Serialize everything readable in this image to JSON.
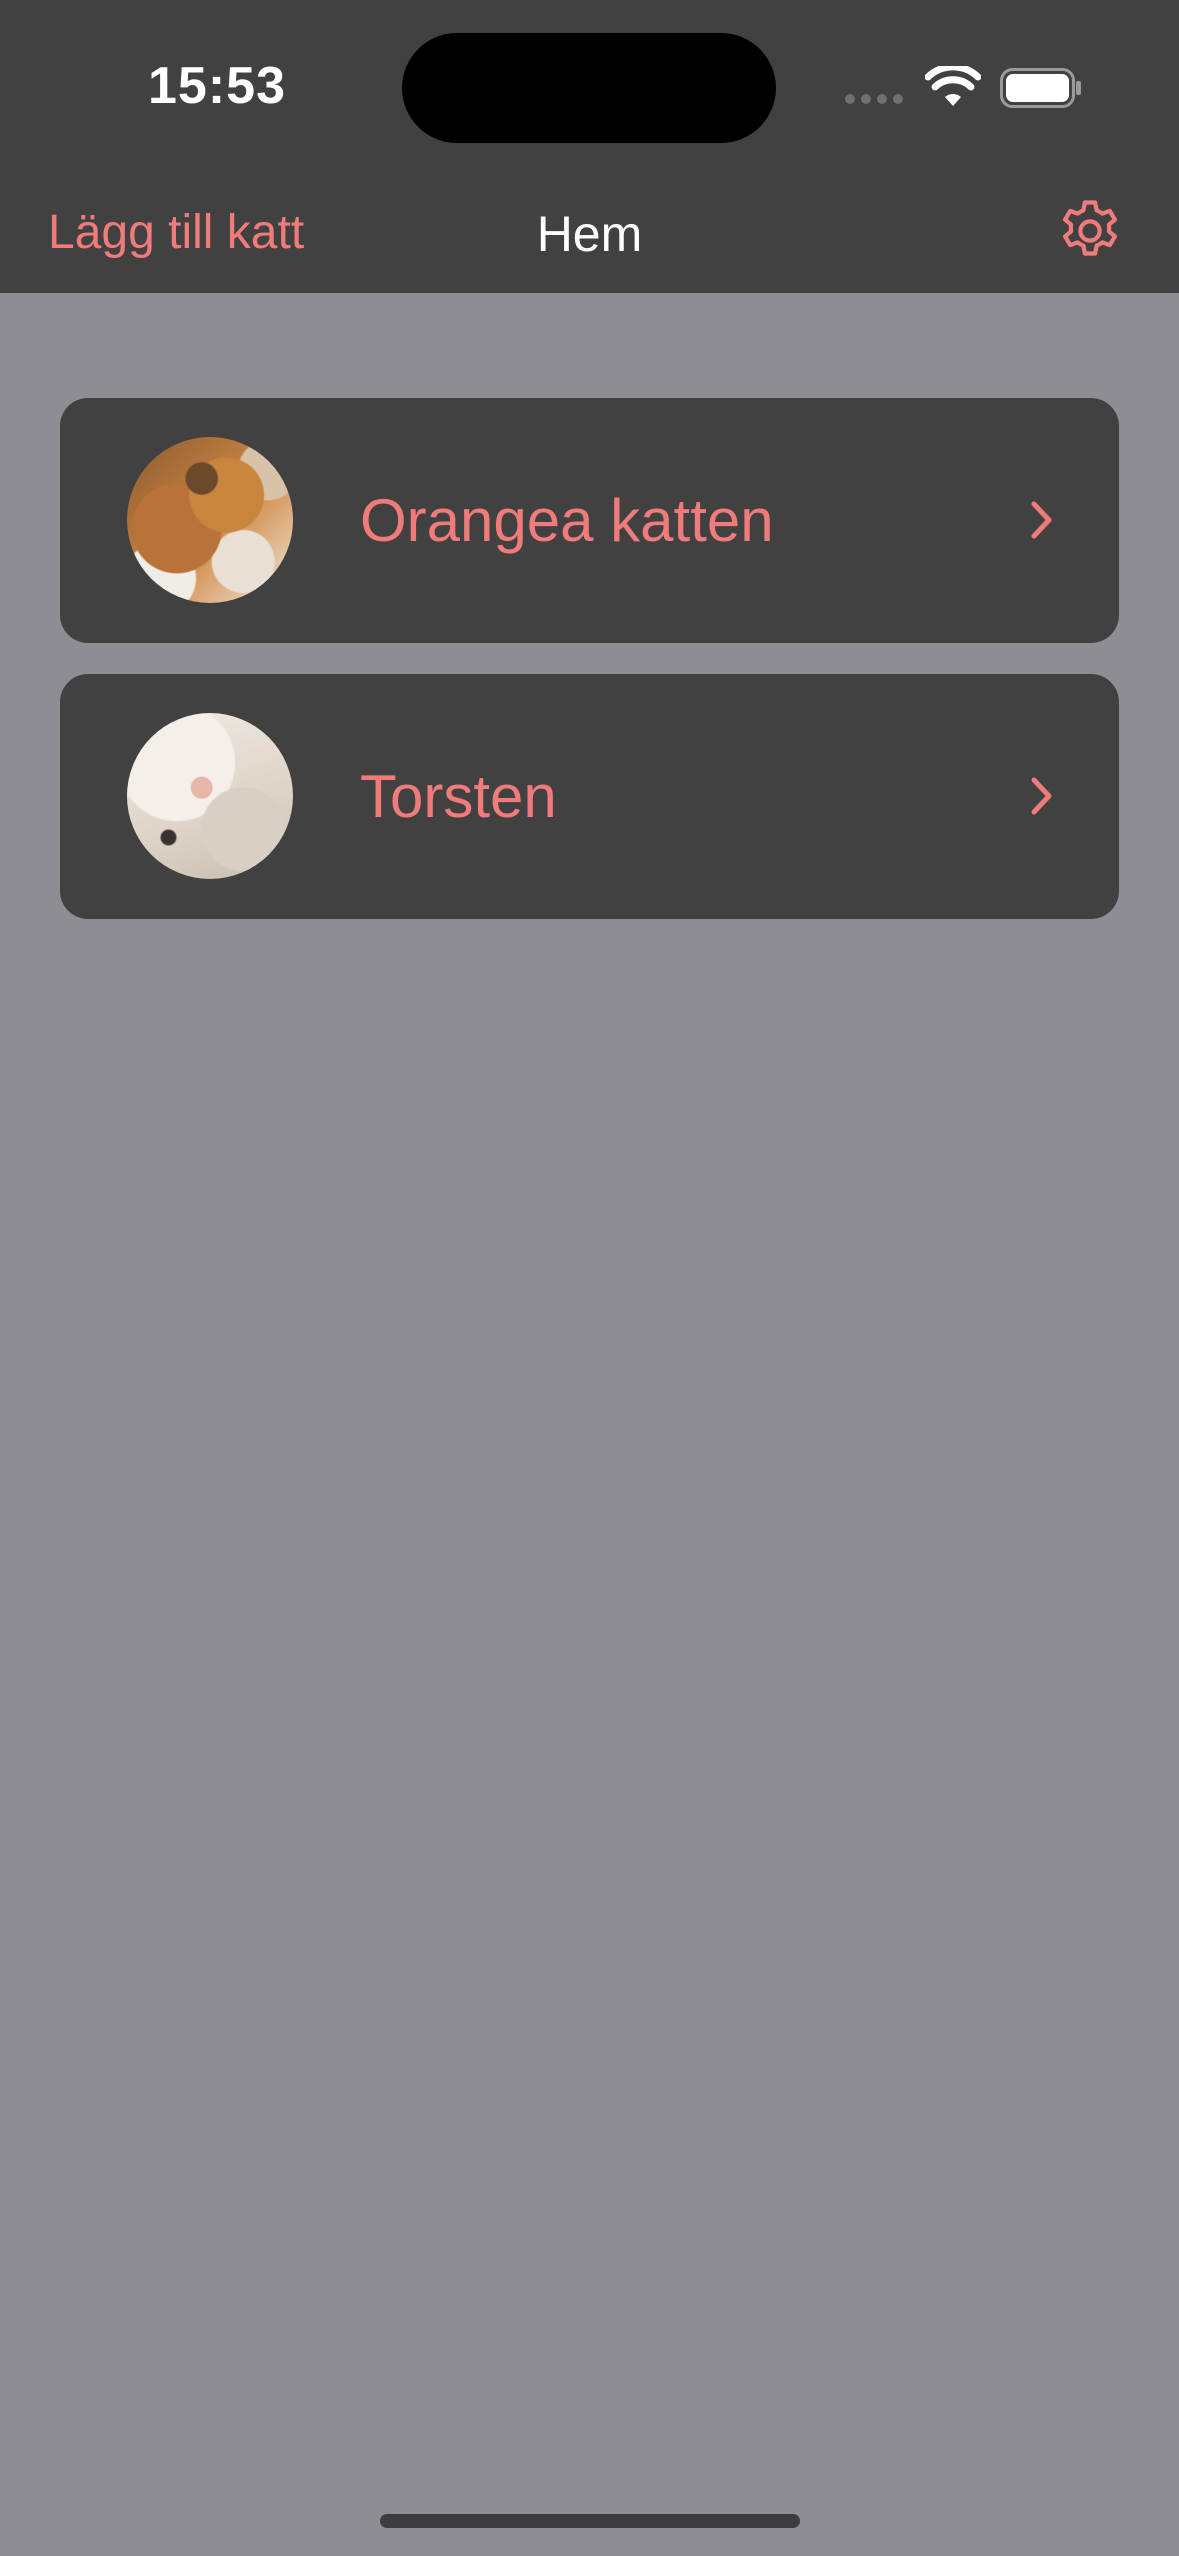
{
  "status_bar": {
    "time": "15:53"
  },
  "nav": {
    "add_label": "Lägg till katt",
    "title": "Hem"
  },
  "cats": [
    {
      "name": "Orangea katten"
    },
    {
      "name": "Torsten"
    }
  ],
  "icons": {
    "settings": "gear-icon",
    "chevron": "chevron-right-icon",
    "wifi": "wifi-icon",
    "battery": "battery-icon"
  },
  "colors": {
    "accent": "#f07b7b",
    "bar_background": "#414141",
    "page_background": "#8e8d93",
    "card_background": "#414141"
  }
}
